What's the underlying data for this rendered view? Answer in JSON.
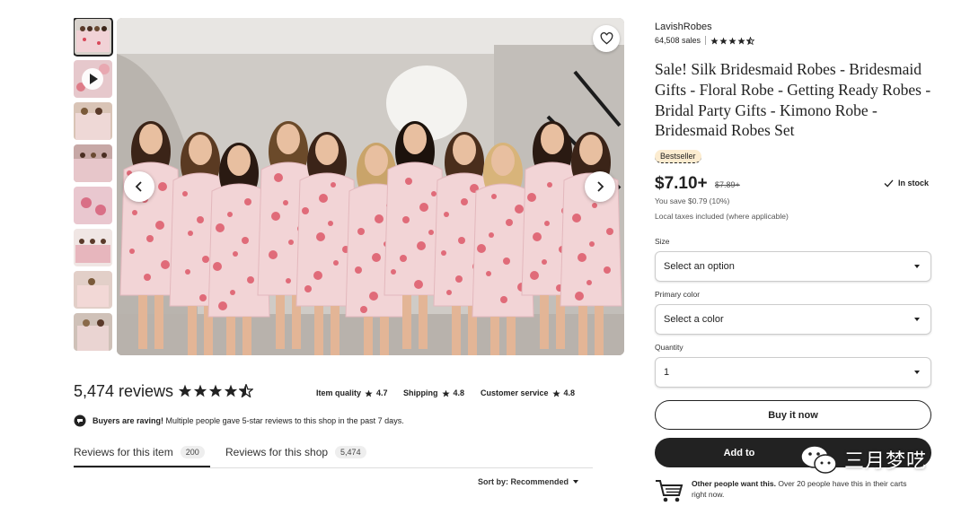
{
  "shop": {
    "name": "LavishRobes",
    "sales": "64,508 sales",
    "rating_stars": 4.5
  },
  "listing": {
    "title": "Sale! Silk Bridesmaid Robes - Bridesmaid Gifts - Floral Robe - Getting Ready Robes - Bridal Party Gifts - Kimono Robe - Bridesmaid Robes Set",
    "badge": "Bestseller",
    "price": "$7.10+",
    "old_price": "$7.89+",
    "stock": "In stock",
    "savings": "You save $0.79 (10%)",
    "taxes": "Local taxes included (where applicable)"
  },
  "options": {
    "size_label": "Size",
    "size_value": "Select an option",
    "color_label": "Primary color",
    "color_value": "Select a color",
    "quantity_label": "Quantity",
    "quantity_value": "1"
  },
  "actions": {
    "buy_now": "Buy it now",
    "add_to_cart": "Add to"
  },
  "others": {
    "bold": "Other people want this.",
    "text": " Over 20 people have this in their carts right now."
  },
  "reviews": {
    "count_label": "5,474 reviews",
    "stars": 4.5,
    "item_quality_label": "Item quality",
    "item_quality": "4.7",
    "shipping_label": "Shipping",
    "shipping": "4.8",
    "customer_service_label": "Customer service",
    "customer_service": "4.8",
    "raving_bold": "Buyers are raving!",
    "raving_text": " Multiple people gave 5-star reviews to this shop in the past 7 days.",
    "tab_item_label": "Reviews for this item",
    "tab_item_count": "200",
    "tab_shop_label": "Reviews for this shop",
    "tab_shop_count": "5,474",
    "sort_label": "Sort by: Recommended"
  },
  "watermark": "三月梦呓",
  "colors": {
    "accent_dark": "#222222",
    "bestseller_bg": "#fcecd0",
    "robe_pink": "#f2d4d6",
    "floral_red": "#d9485a"
  },
  "icons": [
    "play-icon",
    "heart-icon",
    "chevron-left-icon",
    "chevron-right-icon",
    "star-icon",
    "check-icon",
    "caret-down-icon",
    "raving-icon",
    "cart-icon",
    "wechat-icon"
  ]
}
